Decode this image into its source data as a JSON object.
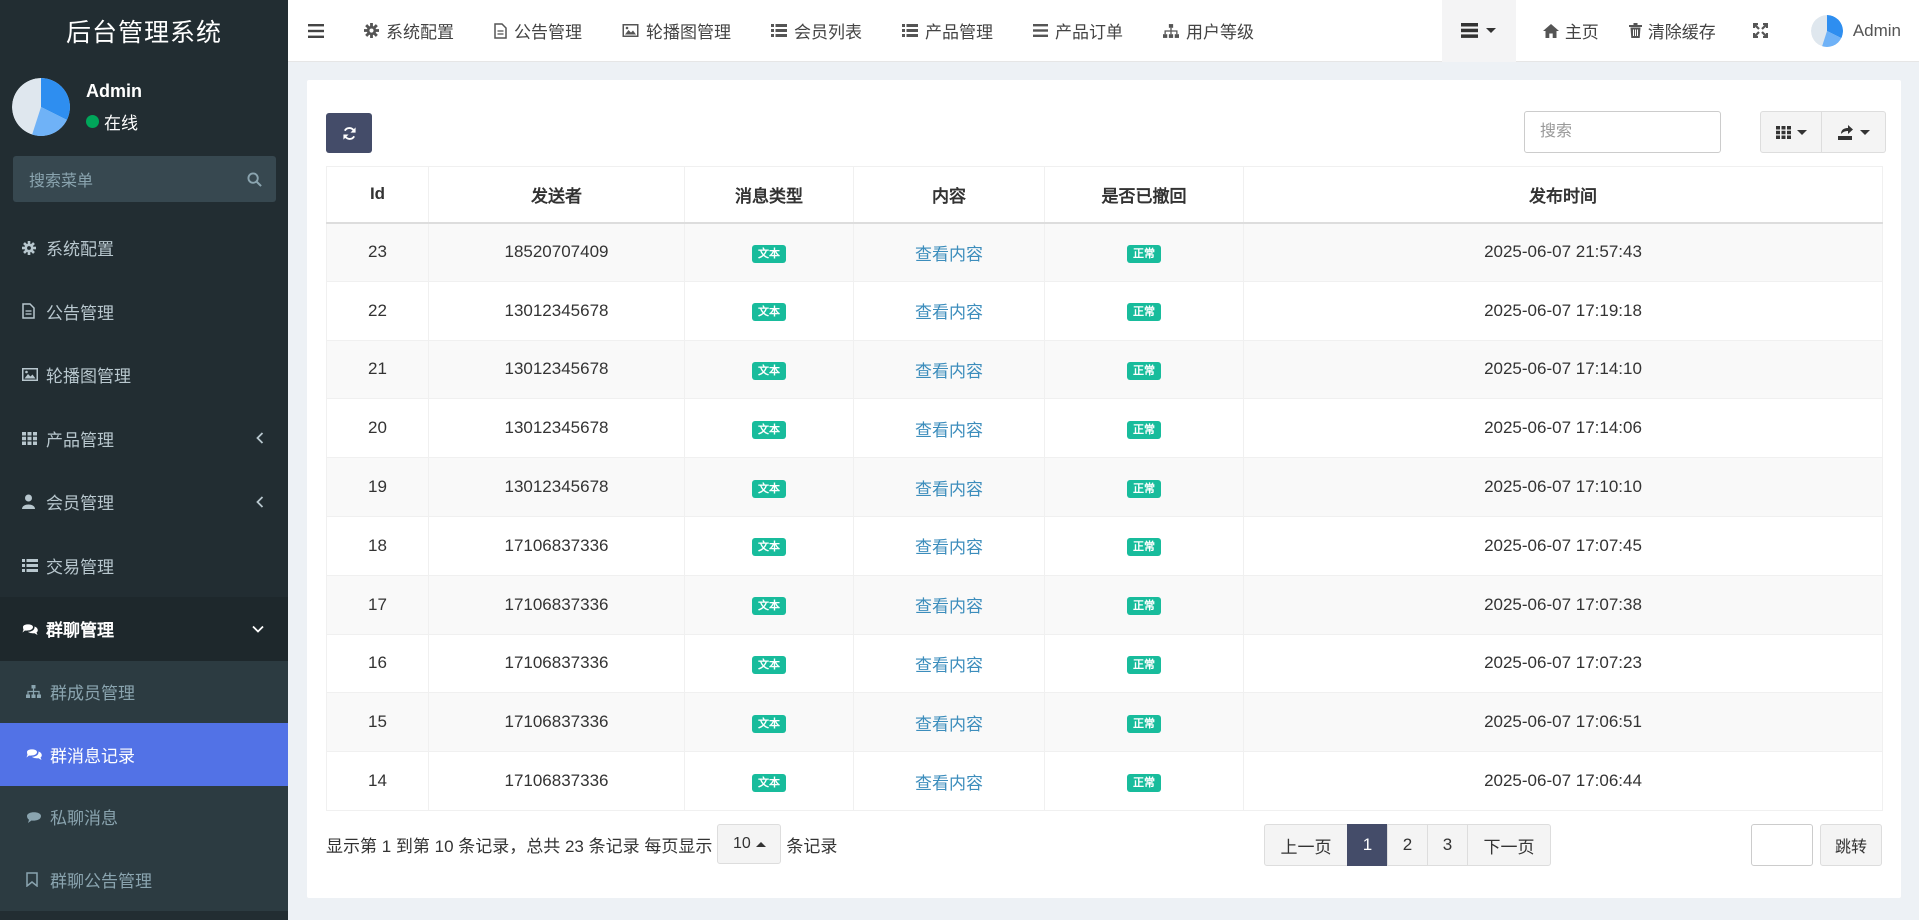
{
  "app": {
    "title": "后台管理系统"
  },
  "user": {
    "name": "Admin",
    "status": "在线"
  },
  "menu_search": {
    "placeholder": "搜索菜单"
  },
  "sidebar": {
    "items": [
      {
        "label": "系统配置",
        "icon": "gear-icon"
      },
      {
        "label": "公告管理",
        "icon": "file-icon"
      },
      {
        "label": "轮播图管理",
        "icon": "image-icon"
      },
      {
        "label": "产品管理",
        "icon": "grid-icon"
      },
      {
        "label": "会员管理",
        "icon": "user-icon"
      },
      {
        "label": "交易管理",
        "icon": "list-icon"
      },
      {
        "label": "群聊管理",
        "icon": "comments-icon"
      }
    ],
    "sub_items": [
      {
        "label": "群成员管理",
        "icon": "sitemap-icon"
      },
      {
        "label": "群消息记录",
        "icon": "comments-icon"
      },
      {
        "label": "私聊消息",
        "icon": "comment-icon"
      },
      {
        "label": "群聊公告管理",
        "icon": "bookmark-icon"
      }
    ]
  },
  "topnav": {
    "tabs": [
      {
        "label": "系统配置",
        "icon": "gear-icon"
      },
      {
        "label": "公告管理",
        "icon": "file-icon"
      },
      {
        "label": "轮播图管理",
        "icon": "image-icon"
      },
      {
        "label": "会员列表",
        "icon": "list-icon"
      },
      {
        "label": "产品管理",
        "icon": "list-icon"
      },
      {
        "label": "产品订单",
        "icon": "bars-icon"
      },
      {
        "label": "用户等级",
        "icon": "sitemap-icon"
      }
    ],
    "home": "主页",
    "clear_cache": "清除缓存",
    "user": "Admin"
  },
  "toolbar": {
    "search_placeholder": "搜索"
  },
  "table": {
    "headers": [
      "Id",
      "发送者",
      "消息类型",
      "内容",
      "是否已撤回",
      "发布时间"
    ],
    "rows": [
      {
        "id": "23",
        "sender": "18520707409",
        "type": "文本",
        "content": "查看内容",
        "revoked": "正常",
        "time": "2025-06-07 21:57:43"
      },
      {
        "id": "22",
        "sender": "13012345678",
        "type": "文本",
        "content": "查看内容",
        "revoked": "正常",
        "time": "2025-06-07 17:19:18"
      },
      {
        "id": "21",
        "sender": "13012345678",
        "type": "文本",
        "content": "查看内容",
        "revoked": "正常",
        "time": "2025-06-07 17:14:10"
      },
      {
        "id": "20",
        "sender": "13012345678",
        "type": "文本",
        "content": "查看内容",
        "revoked": "正常",
        "time": "2025-06-07 17:14:06"
      },
      {
        "id": "19",
        "sender": "13012345678",
        "type": "文本",
        "content": "查看内容",
        "revoked": "正常",
        "time": "2025-06-07 17:10:10"
      },
      {
        "id": "18",
        "sender": "17106837336",
        "type": "文本",
        "content": "查看内容",
        "revoked": "正常",
        "time": "2025-06-07 17:07:45"
      },
      {
        "id": "17",
        "sender": "17106837336",
        "type": "文本",
        "content": "查看内容",
        "revoked": "正常",
        "time": "2025-06-07 17:07:38"
      },
      {
        "id": "16",
        "sender": "17106837336",
        "type": "文本",
        "content": "查看内容",
        "revoked": "正常",
        "time": "2025-06-07 17:07:23"
      },
      {
        "id": "15",
        "sender": "17106837336",
        "type": "文本",
        "content": "查看内容",
        "revoked": "正常",
        "time": "2025-06-07 17:06:51"
      },
      {
        "id": "14",
        "sender": "17106837336",
        "type": "文本",
        "content": "查看内容",
        "revoked": "正常",
        "time": "2025-06-07 17:06:44"
      }
    ]
  },
  "pagination": {
    "info_prefix": "显示第 1 到第 10 条记录，总共 23 条记录 每页显示",
    "page_size": "10",
    "info_suffix": "条记录",
    "prev": "上一页",
    "pages": [
      "1",
      "2",
      "3"
    ],
    "next": "下一页",
    "jump": "跳转"
  },
  "colors": {
    "sidebar_bg": "#222d32",
    "active_item": "#5272e6",
    "label_green": "#18bc9c",
    "link": "#3c8dbc",
    "primary_dark": "#444c69"
  }
}
